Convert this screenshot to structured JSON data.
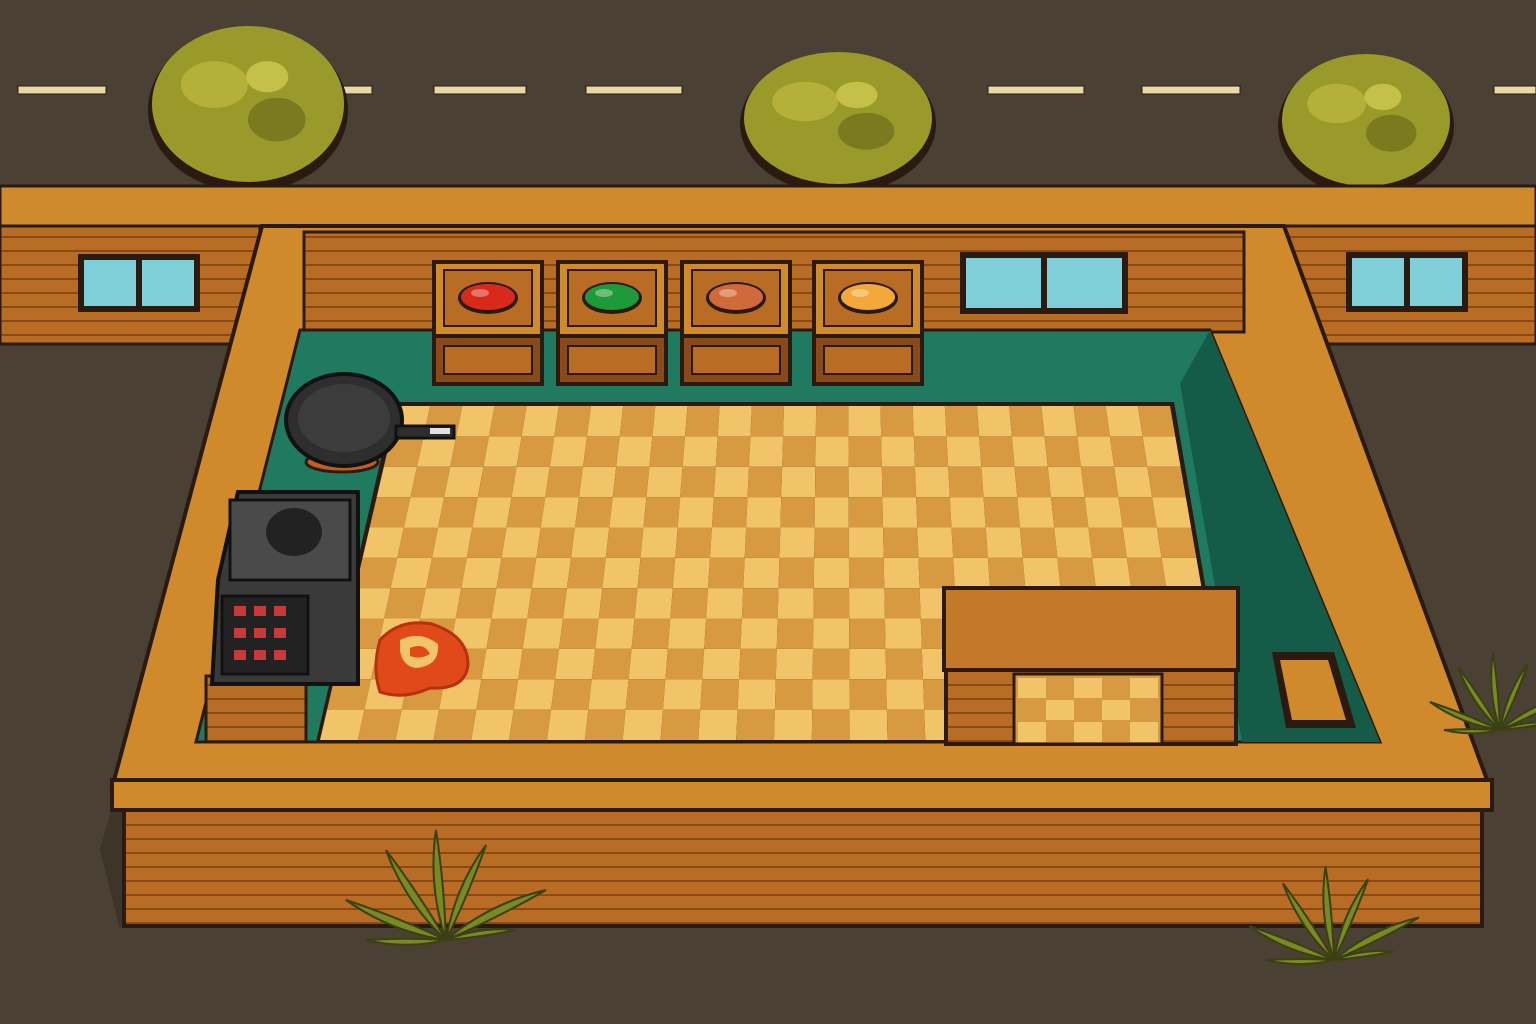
{
  "scene": {
    "type": "top-down kitchen",
    "colors": {
      "ground": "#4a4034",
      "road_marking": "#e8d8a8",
      "wood_light": "#d08a2c",
      "wood_mid": "#b86c24",
      "wood_dark": "#8a4a18",
      "outline": "#2a1a10",
      "teal_counter": "#1f7a60",
      "teal_dark": "#155c48",
      "tile_light": "#f2c46a",
      "tile_dark": "#d89a40",
      "window_glass": "#7fd0d8",
      "bush": "#9a9a2a",
      "plant": "#7a8a22"
    }
  },
  "background": {
    "bushes": [
      "bush-icon",
      "bush-icon",
      "bush-icon"
    ],
    "plants": [
      "plant-icon",
      "plant-icon",
      "plant-icon"
    ]
  },
  "ingredient_crates": [
    {
      "name": "tomato",
      "icon": "tomato-icon",
      "color": "#d82a1a"
    },
    {
      "name": "lettuce",
      "icon": "lettuce-icon",
      "color": "#1e9a3a"
    },
    {
      "name": "onion",
      "icon": "onion-icon",
      "color": "#d06a3a"
    },
    {
      "name": "cheese",
      "icon": "cheese-icon",
      "color": "#f2a83a"
    }
  ],
  "appliances": {
    "frying_pan": "frying-pan-icon",
    "stove": "stove-icon",
    "serving_counter": "serving-counter-icon",
    "trash_hatch": "trash-hatch-icon"
  },
  "floor": {
    "spill": "sauce-spill-icon"
  }
}
